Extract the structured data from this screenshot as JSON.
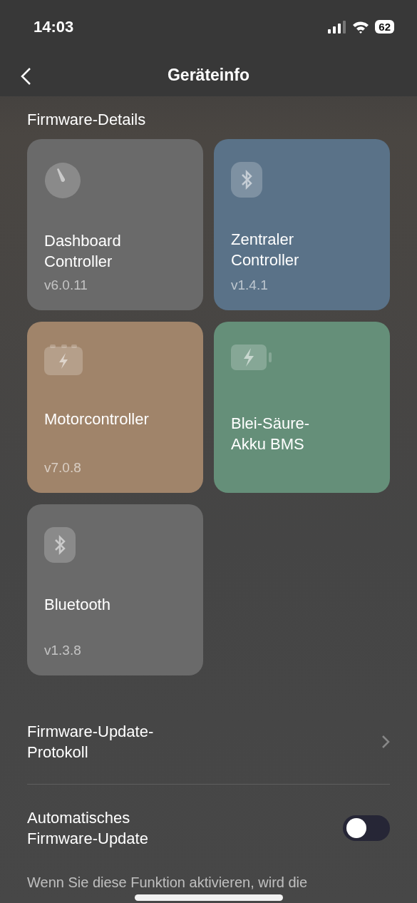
{
  "status_bar": {
    "time": "14:03",
    "battery": "62"
  },
  "header": {
    "title": "Geräteinfo"
  },
  "section_title": "Firmware-Details",
  "modules": [
    {
      "kind": "gauge",
      "name": "Dashboard Controller",
      "version": "v6.0.11",
      "color": "#6a6a6a"
    },
    {
      "kind": "bluetooth",
      "name": "Zentraler Controller",
      "version": "v1.4.1",
      "color": "#5a7288"
    },
    {
      "kind": "motor",
      "name": "Motorcontroller",
      "version": "v7.0.8",
      "color": "#a0846a"
    },
    {
      "kind": "battery",
      "name": "Blei-Säure-Akku BMS",
      "color": "#658f79"
    },
    {
      "kind": "bluetooth",
      "name": "Bluetooth",
      "version": "v1.3.8",
      "color": "#6a6a6a"
    }
  ],
  "update_log": {
    "label": "Firmware-Update-Protokoll"
  },
  "auto_update": {
    "label": "Automatisches Firmware-Update",
    "on": false,
    "description": "Wenn Sie diese Funktion aktivieren, wird die"
  }
}
